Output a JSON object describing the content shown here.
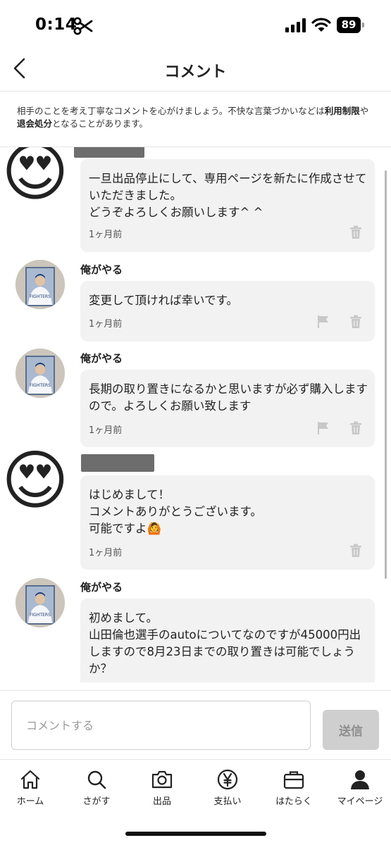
{
  "status_bar": {
    "time": "0:14",
    "battery": "89"
  },
  "header": {
    "title": "コメント"
  },
  "notice": {
    "text_1": "相手のことを考え丁寧なコメントを心がけましょう。不快な言葉づかいなどは",
    "link_1": "利用制限",
    "text_2": "や",
    "link_2": "退会処分",
    "text_3": "となることがあります。"
  },
  "comments": [
    {
      "user": "",
      "avatar": "heart-eyes-emoji",
      "text": "一旦出品停止にして、専用ページを新たに作成させていただきました。\nどうぞよろしくお願いします^ ^",
      "time": "1ヶ月前"
    },
    {
      "user": "俺がやる",
      "avatar": "baseball-player-photo",
      "text": "変更して頂ければ幸いです。",
      "time": "1ヶ月前"
    },
    {
      "user": "俺がやる",
      "avatar": "baseball-player-photo",
      "text": "長期の取り置きになるかと思いますが必ず購入しますので。よろしくお願い致します",
      "time": "1ヶ月前"
    },
    {
      "user": "",
      "avatar": "heart-eyes-emoji",
      "text": "はじめまして！\nコメントありがとうございます。\n可能ですよ🙆",
      "time": "1ヶ月前"
    },
    {
      "user": "俺がやる",
      "avatar": "baseball-player-photo",
      "text": "初めまして。\n山田倫也選手のautoについてなのですが45000円出しますので8月23日までの取り置きは可能でしょうか？",
      "time": ""
    }
  ],
  "input": {
    "placeholder": "コメントする",
    "send_label": "送信"
  },
  "nav": {
    "items": [
      {
        "label": "ホーム",
        "icon": "home-icon"
      },
      {
        "label": "さがす",
        "icon": "search-icon"
      },
      {
        "label": "出品",
        "icon": "camera-icon"
      },
      {
        "label": "支払い",
        "icon": "yen-icon"
      },
      {
        "label": "はたらく",
        "icon": "briefcase-icon"
      },
      {
        "label": "マイページ",
        "icon": "person-icon"
      }
    ]
  },
  "emoji": {
    "heart_eyes": "😍"
  },
  "colors": {
    "bubble_bg": "#f2f2f2",
    "send_button_bg": "#cfcfcf",
    "text": "#222222"
  }
}
